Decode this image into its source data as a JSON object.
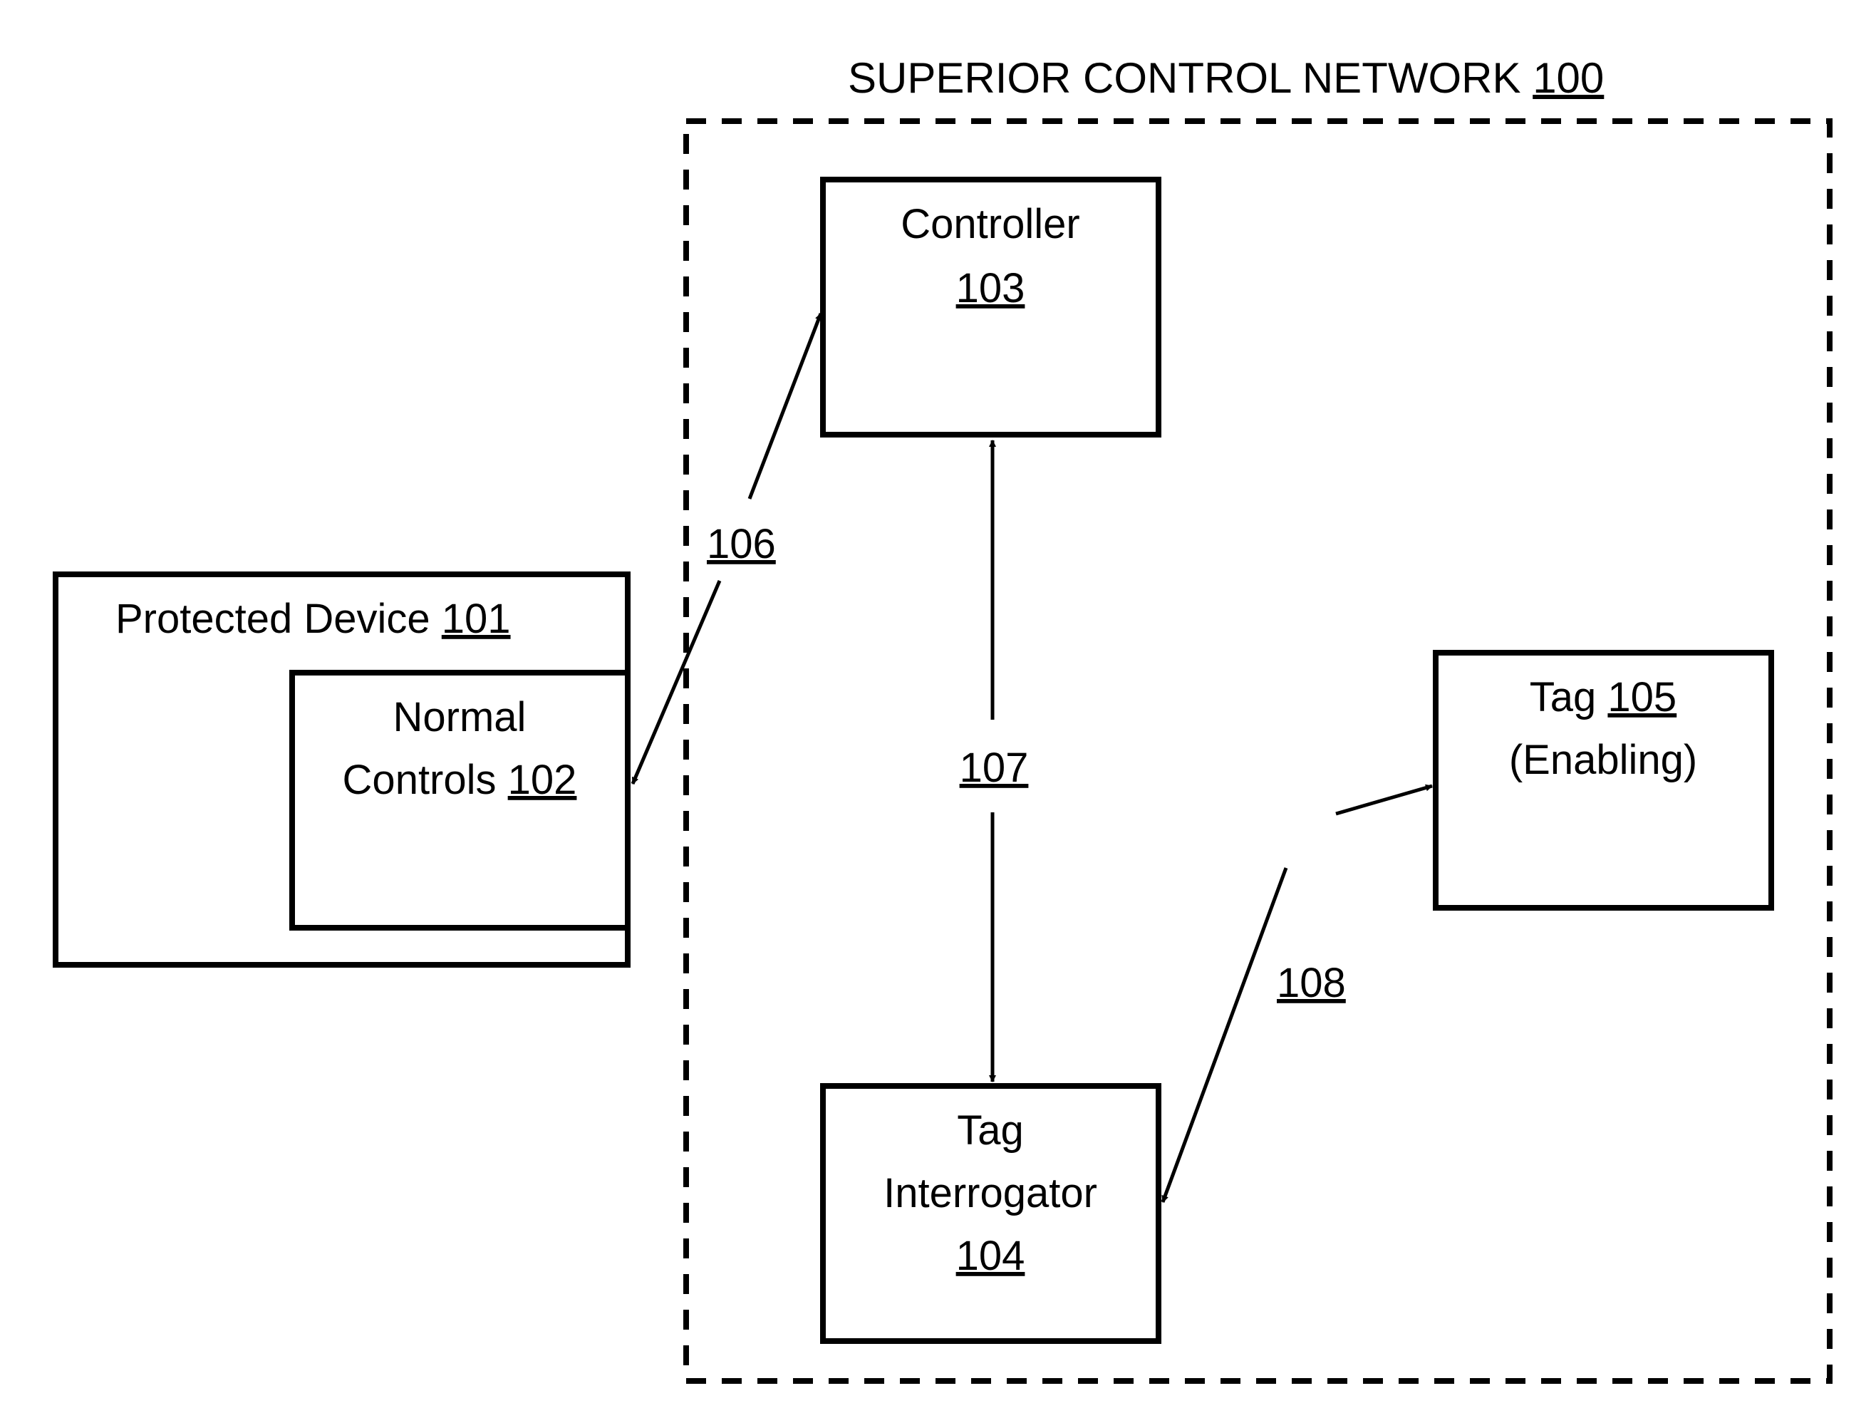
{
  "network": {
    "title": "SUPERIOR CONTROL NETWORK",
    "ref": "100"
  },
  "protected_device": {
    "label": "Protected Device",
    "ref": "101"
  },
  "normal_controls": {
    "line1": "Normal",
    "line2": "Controls",
    "ref": "102"
  },
  "controller": {
    "label": "Controller",
    "ref": "103"
  },
  "tag_interrogator": {
    "line1": "Tag",
    "line2": "Interrogator",
    "ref": "104"
  },
  "tag": {
    "label": "Tag",
    "ref": "105",
    "sub": "(Enabling)"
  },
  "links": {
    "l106": "106",
    "l107": "107",
    "l108": "108"
  },
  "colors": {
    "stroke": "#000000",
    "background": "#ffffff"
  }
}
